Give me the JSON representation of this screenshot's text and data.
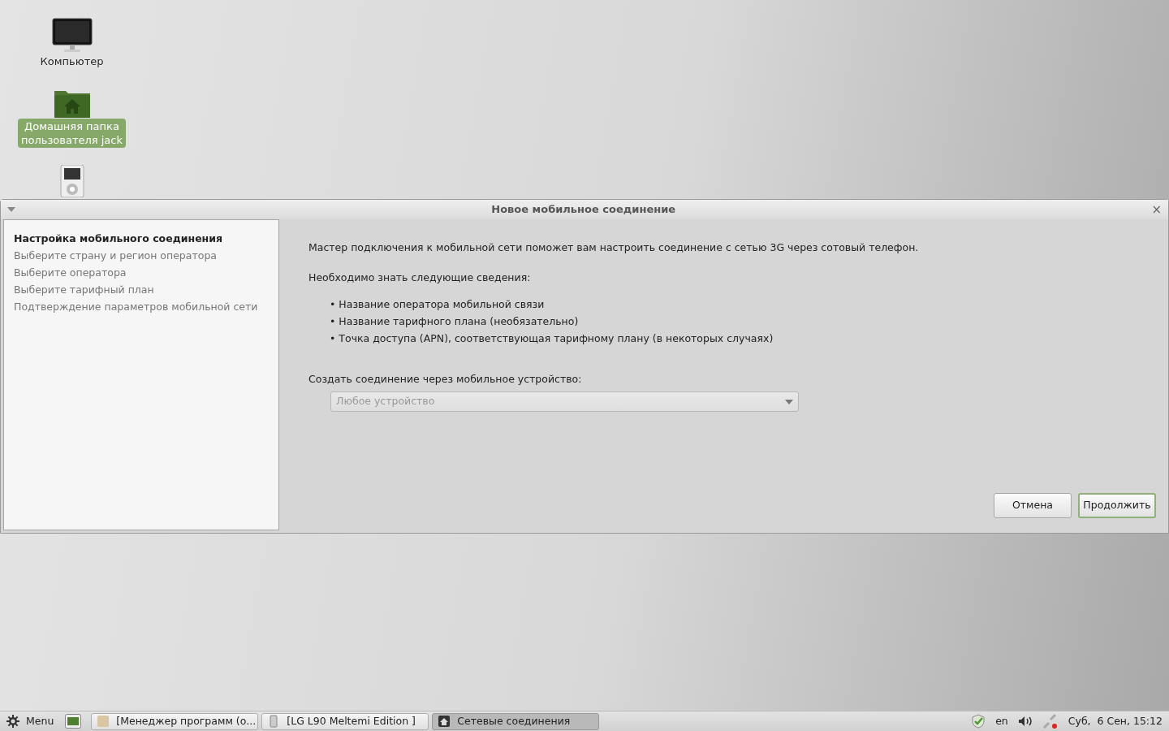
{
  "desktop_icons": [
    {
      "kind": "computer",
      "label": "Компьютер",
      "selected": false
    },
    {
      "kind": "home",
      "label": "Домашняя папка\nпользователя jack",
      "selected": true
    },
    {
      "kind": "player",
      "selected": false
    }
  ],
  "window": {
    "title": "Новое мобильное соединение",
    "close": "×",
    "steps": [
      {
        "label": "Настройка мобильного соединения",
        "selected": true
      },
      {
        "label": "Выберите страну и регион оператора",
        "selected": false
      },
      {
        "label": "Выберите оператора",
        "selected": false
      },
      {
        "label": "Выберите тарифный план",
        "selected": false
      },
      {
        "label": "Подтверждение параметров мобильной сети",
        "selected": false
      }
    ],
    "intro": "Мастер подключения к мобильной сети поможет вам настроить соединение с сетью 3G через сотовый телефон.",
    "needed": "Необходимо знать следующие сведения:",
    "items": [
      "• Название оператора мобильной связи",
      "• Название тарифного плана (необязательно)",
      "• Точка доступа (APN), соответствующая тарифному плану (в некоторых случаях)"
    ],
    "device_label": "Создать соединение через мобильное устройство:",
    "device_select": {
      "value": "Любое устройство",
      "disabled": true
    },
    "buttons": [
      {
        "label": "Отмена",
        "default": false
      },
      {
        "label": "Продолжить",
        "default": true
      }
    ]
  },
  "taskbar": {
    "menu": "Menu",
    "tasks": [
      {
        "label": "[Менеджер программ (о...",
        "selected": false
      },
      {
        "label": "[LG L90 Meltemi Edition ]",
        "selected": false
      },
      {
        "label": "Сетевые соединения",
        "selected": true
      }
    ],
    "keyboard": "en",
    "clock": "Суб,  6 Сен, 15:12"
  }
}
